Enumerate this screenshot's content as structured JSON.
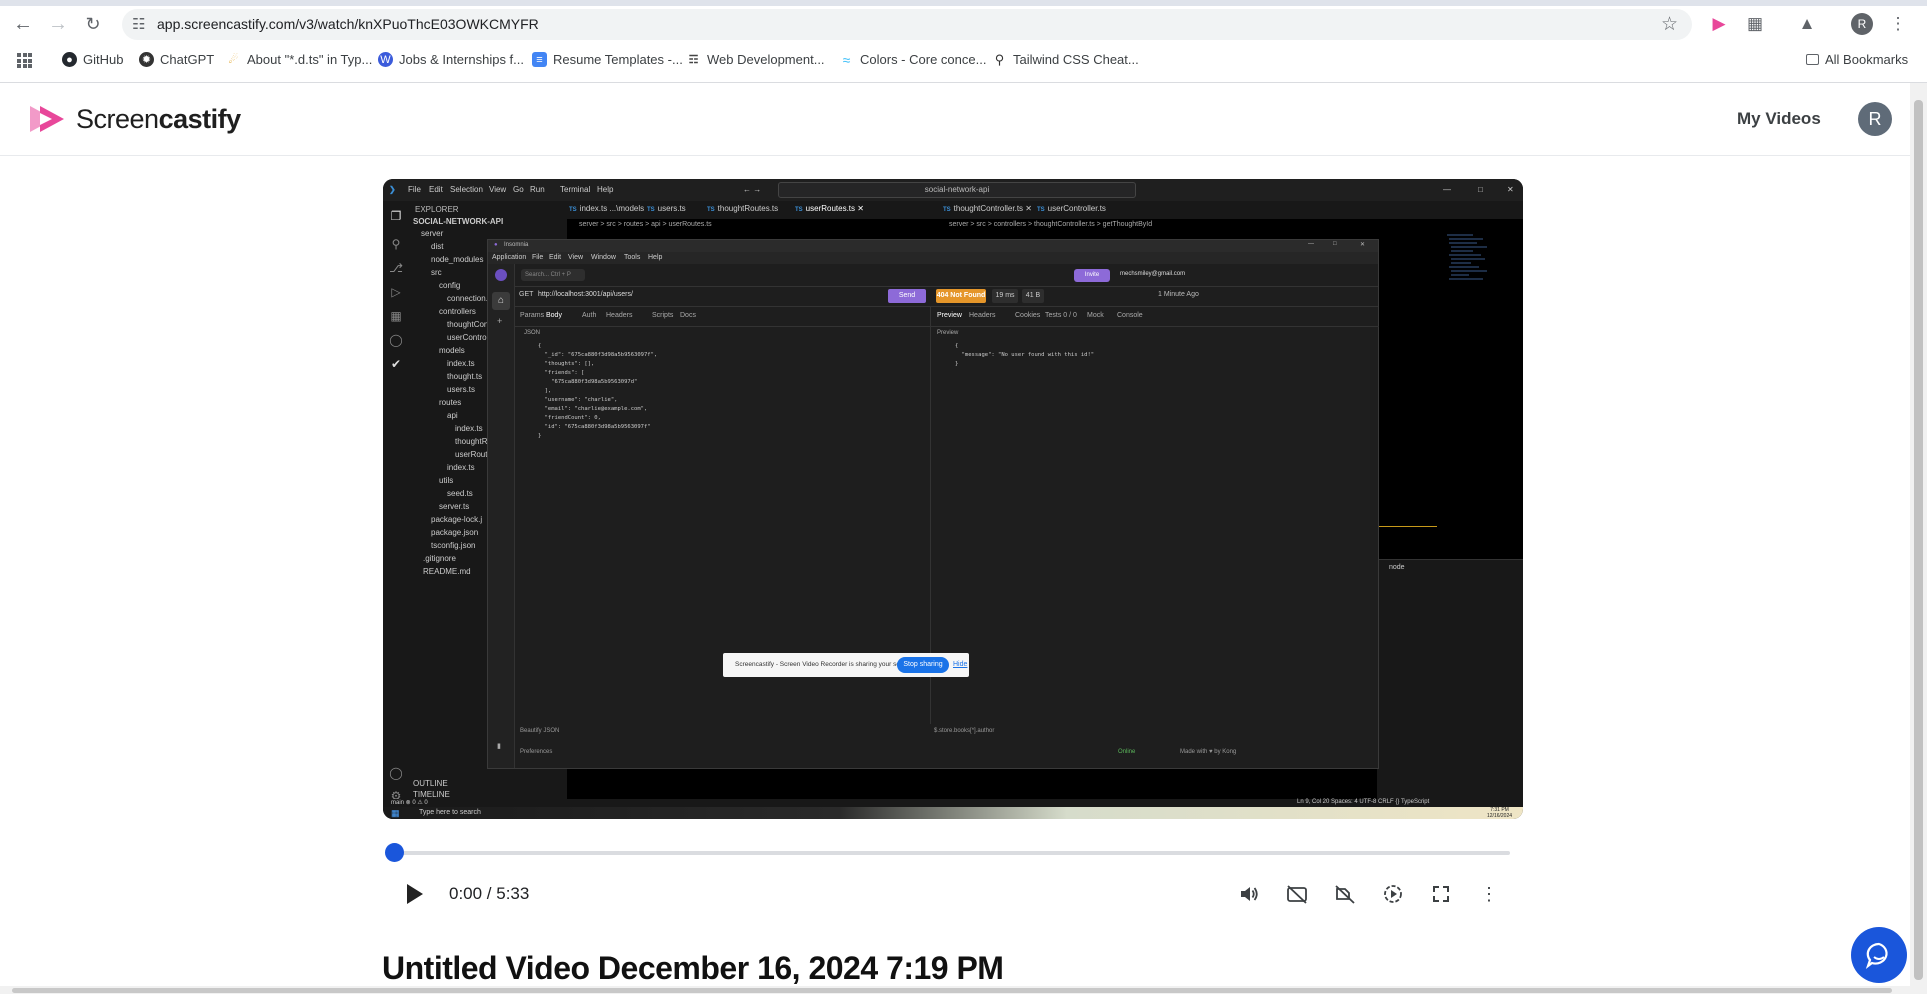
{
  "browser": {
    "url": "app.screencastify.com/v3/watch/knXPuoThcE03OWKCMYFR",
    "profile_initial": "R",
    "bookmarks": [
      {
        "label": "GitHub",
        "icon": "github-icon"
      },
      {
        "label": "ChatGPT",
        "icon": "chatgpt-icon"
      },
      {
        "label": "About \"*.d.ts\" in Typ...",
        "icon": "web-icon"
      },
      {
        "label": "Jobs & Internships f...",
        "icon": "web-icon"
      },
      {
        "label": "Resume Templates -...",
        "icon": "doc-icon"
      },
      {
        "label": "Web Development...",
        "icon": "web-icon"
      },
      {
        "label": "Colors - Core conce...",
        "icon": "tailwind-icon"
      },
      {
        "label": "Tailwind CSS Cheat...",
        "icon": "search-icon"
      }
    ],
    "all_bookmarks": "All Bookmarks"
  },
  "header": {
    "brand_light": "Screen",
    "brand_bold": "castify",
    "my_videos": "My Videos",
    "avatar_initial": "R"
  },
  "recording": {
    "vscode": {
      "menu": [
        "File",
        "Edit",
        "Selection",
        "View",
        "Go",
        "Run",
        "Terminal",
        "Help"
      ],
      "search": "social-network-api",
      "explorer_title": "EXPLORER",
      "project": "SOCIAL-NETWORK-API",
      "tree": [
        "server",
        "dist",
        "node_modules",
        "src",
        "config",
        "connection.ts",
        "controllers",
        "thoughtCont...",
        "userControll...",
        "models",
        "index.ts",
        "thought.ts",
        "users.ts",
        "routes",
        "api",
        "index.ts",
        "thoughtRo...",
        "userRoute...",
        "index.ts",
        "utils",
        "seed.ts",
        "server.ts",
        "package-lock.j",
        "package.json",
        "tsconfig.json",
        ".gitignore",
        "README.md"
      ],
      "outline": "OUTLINE",
      "timeline": "TIMELINE",
      "tabs": [
        "index.ts ...\\models",
        "users.ts",
        "thoughtRoutes.ts",
        "userRoutes.ts",
        "thoughtController.ts",
        "userController.ts"
      ],
      "crumb_left": "server > src > routes > api > userRoutes.ts",
      "crumb_right": "server > src > controllers > thoughtController.ts > getThoughtById",
      "status_left": "main ⊗ 0 ⚠ 0",
      "status_right": "Ln 9, Col 20   Spaces: 4   UTF-8   CRLF   {} TypeScript",
      "terminal_label": "node"
    },
    "insomnia": {
      "title": "Insomnia",
      "menu": [
        "Application",
        "File",
        "Edit",
        "View",
        "Window",
        "Tools",
        "Help"
      ],
      "search_placeholder": "Search... Ctrl + P",
      "invite": "Invite",
      "email": "mechsmiley@gmail.com",
      "method": "GET",
      "url": "http://localhost:3001/api/users/",
      "send": "Send",
      "status": "404 Not Found",
      "time": "19 ms",
      "size": "41 B",
      "ago": "1 Minute Ago",
      "req_tabs": [
        "Params",
        "Body",
        "Auth",
        "Headers",
        "Scripts",
        "Docs"
      ],
      "resp_tabs": [
        "Preview",
        "Headers",
        "Cookies",
        "Tests 0 / 0",
        "Mock",
        "Console"
      ],
      "body_mode": "JSON",
      "preview_mode": "Preview",
      "request_body": "{\n  \"_id\": \"675ca880f3d98a5b9563097f\",\n  \"thoughts\": [],\n  \"friends\": [\n    \"675ca880f3d98a5b9563097d\"\n  ],\n  \"username\": \"charlie\",\n  \"email\": \"charlie@example.com\",\n  \"friendCount\": 0,\n  \"id\": \"675ca880f3d98a5b9563097f\"\n}",
      "response_body": "{\n  \"message\": \"No user found with this id!\"\n}",
      "beautify": "Beautify JSON",
      "filter": "$.store.books[*].author",
      "preferences": "Preferences",
      "online": "Online",
      "made_with": "Made with ♥ by Kong"
    },
    "share_bar": {
      "text": "Screencastify - Screen Video Recorder is sharing your screen.",
      "stop": "Stop sharing",
      "hide": "Hide"
    },
    "taskbar": {
      "search": "Type here to search",
      "time": "7:31 PM",
      "date": "12/16/2024"
    }
  },
  "player": {
    "progress": 0.0,
    "time": "0:00 / 5:33",
    "controls": [
      "volume-icon",
      "captions-off-icon",
      "audio-description-icon",
      "playback-speed-icon",
      "fullscreen-icon",
      "more-options-icon"
    ]
  },
  "video_title": "Untitled Video December 16, 2024 7:19 PM",
  "colors": {
    "brand_pink": "#e8479a",
    "accent_blue": "#1a56db",
    "insomnia_purple": "#8d6ad8",
    "status_orange": "#e5962a"
  }
}
